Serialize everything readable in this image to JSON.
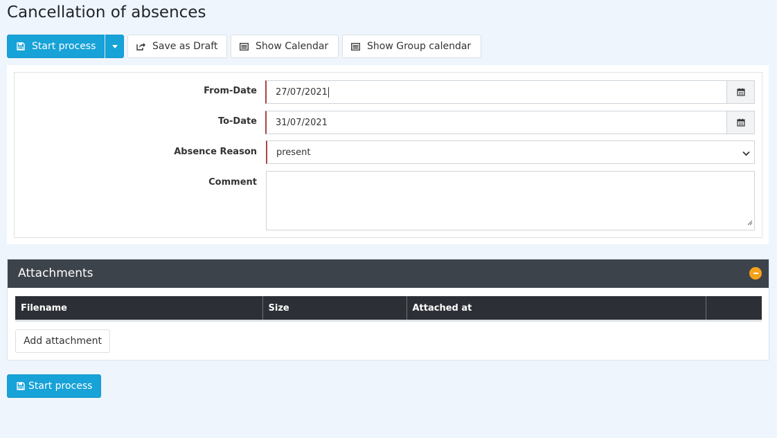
{
  "page": {
    "title": "Cancellation of absences"
  },
  "toolbar": {
    "start_process": "Start process",
    "save_draft": "Save as Draft",
    "show_calendar": "Show Calendar",
    "show_group_calendar": "Show Group calendar"
  },
  "form": {
    "from_date": {
      "label": "From-Date",
      "value": "27/07/2021"
    },
    "to_date": {
      "label": "To-Date",
      "value": "31/07/2021"
    },
    "absence_reason": {
      "label": "Absence Reason",
      "value": "present"
    },
    "comment": {
      "label": "Comment",
      "value": ""
    }
  },
  "attachments": {
    "title": "Attachments",
    "columns": [
      "Filename",
      "Size",
      "Attached at",
      ""
    ],
    "add_label": "Add attachment"
  },
  "footer": {
    "start_process": "Start process"
  },
  "colors": {
    "primary": "#17a2d8",
    "header_dark": "#3d434b",
    "required": "#a94442",
    "collapse": "#f5a21b"
  }
}
